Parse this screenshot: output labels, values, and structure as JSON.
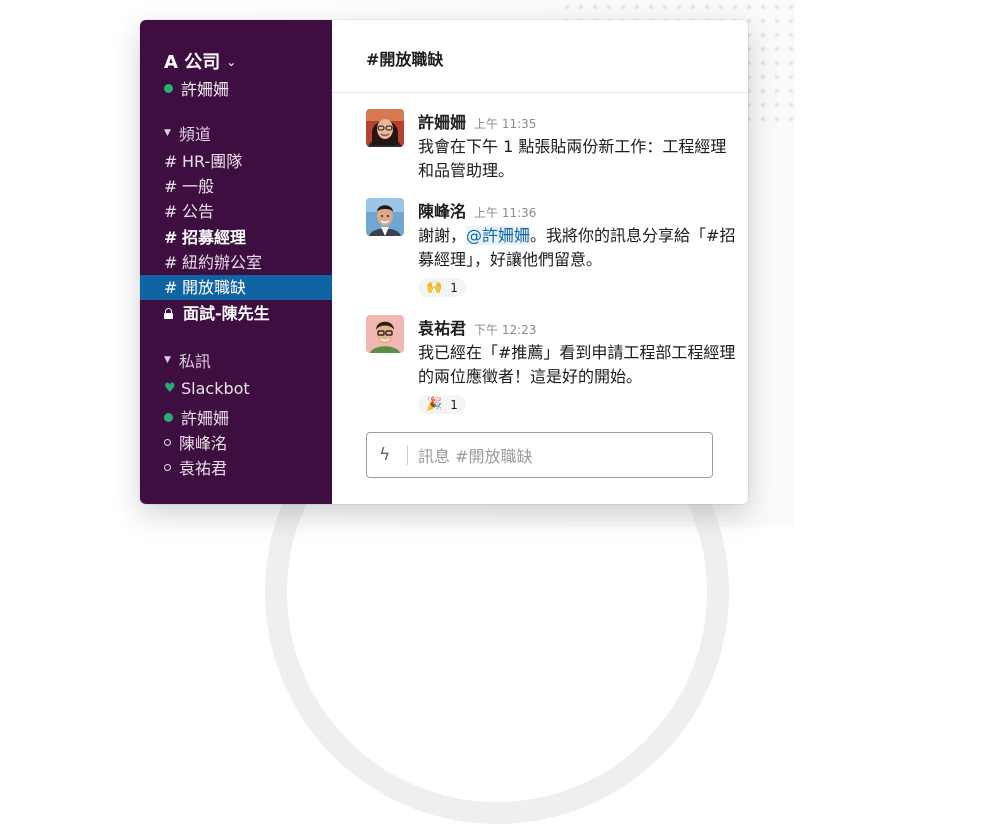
{
  "workspace": {
    "name": "A 公司",
    "user": "許姍姍"
  },
  "sidebar": {
    "channels_header": "頻道",
    "channels": [
      {
        "prefix": "#",
        "label": "HR-團隊"
      },
      {
        "prefix": "#",
        "label": "一般"
      },
      {
        "prefix": "#",
        "label": "公告"
      },
      {
        "prefix": "#",
        "label": "招募經理"
      },
      {
        "prefix": "#",
        "label": "紐約辦公室"
      },
      {
        "prefix": "#",
        "label": "開放職缺"
      },
      {
        "prefix": "",
        "label": "面試-陳先生"
      }
    ],
    "dms_header": "私訊",
    "dms": [
      {
        "label": "Slackbot",
        "status": "heart"
      },
      {
        "label": "許姍姍",
        "status": "online"
      },
      {
        "label": "陳峰洺",
        "status": "away"
      },
      {
        "label": "袁祐君",
        "status": "away"
      }
    ]
  },
  "channel": {
    "title": "#開放職缺"
  },
  "messages": [
    {
      "name": "許姍姍",
      "time": "上午 11:35",
      "text": "我會在下午 1 點張貼兩份新工作：工程經理和品管助理。"
    },
    {
      "name": "陳峰洺",
      "time": "上午 11:36",
      "text_before": "謝謝，",
      "mention": "@許姍姍",
      "text_after": "。我將你的訊息分享給「#招募經理」，好讓他們留意。",
      "reaction": {
        "emoji": "🙌",
        "count": "1"
      }
    },
    {
      "name": "袁祐君",
      "time": "下午 12:23",
      "text": "我已經在「#推薦」看到申請工程部工程經理的兩位應徵者！這是好的開始。",
      "reaction": {
        "emoji": "🎉",
        "count": "1"
      }
    }
  ],
  "composer": {
    "placeholder": "訊息 #開放職缺"
  },
  "colors": {
    "sidebar_bg": "#3f0e40",
    "active_channel": "#1164a3",
    "online": "#2bac76",
    "mention": "#1264a3"
  }
}
